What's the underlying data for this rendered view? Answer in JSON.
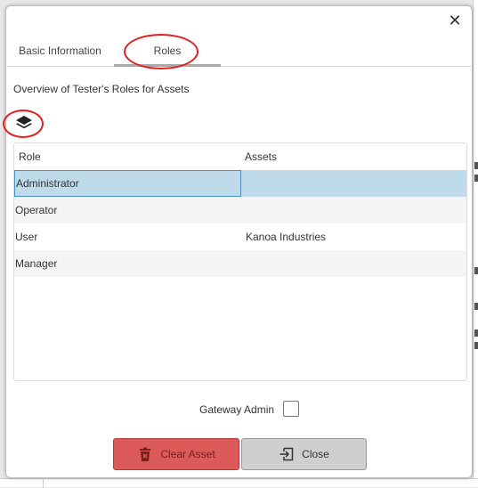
{
  "dialog": {
    "close_glyph": "✕",
    "tabs": [
      {
        "label": "Basic Information"
      },
      {
        "label": "Roles"
      }
    ],
    "active_tab": "Roles",
    "subtitle": "Overview of Tester's Roles for Assets",
    "layers_icon": "layers-icon",
    "table": {
      "headers": [
        "Role",
        "Assets"
      ],
      "rows": [
        {
          "role": "Administrator",
          "assets": "",
          "selected": true
        },
        {
          "role": "Operator",
          "assets": ""
        },
        {
          "role": "User",
          "assets": "Kanoa Industries"
        },
        {
          "role": "Manager",
          "assets": ""
        }
      ]
    },
    "gateway_admin": {
      "label": "Gateway Admin",
      "checked": false
    },
    "buttons": {
      "clear_asset": "Clear Asset",
      "close": "Close"
    }
  },
  "annotations": {
    "color": "#e02020"
  },
  "colors": {
    "selected_row": "#bfdbea",
    "danger_button": "#dd5a5a",
    "secondary_button": "#cfcfcf"
  }
}
